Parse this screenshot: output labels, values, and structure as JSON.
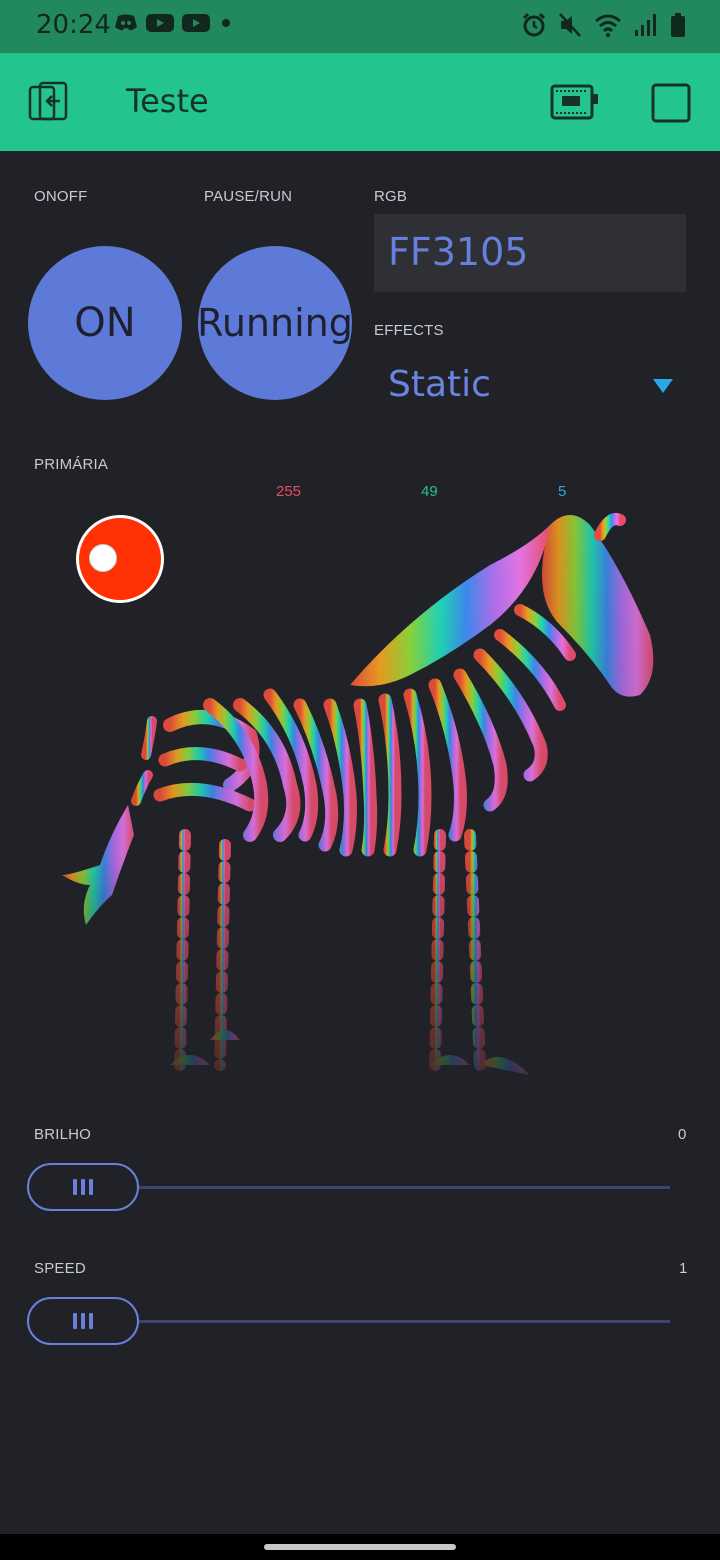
{
  "status_bar": {
    "time": "20:24",
    "left_icons": [
      "discord-icon",
      "youtube-icon",
      "youtube-icon",
      "dot-icon"
    ],
    "right_icons": [
      "alarm-icon",
      "mute-icon",
      "wifi-icon",
      "signal-icon",
      "battery-icon"
    ]
  },
  "app_bar": {
    "title": "Teste",
    "left_icon": "exit-device-icon",
    "right_icons": [
      "device-board-icon",
      "square-stop-icon"
    ]
  },
  "widgets": {
    "onoff": {
      "label": "ONOFF",
      "button_text": "ON"
    },
    "pause_run": {
      "label": "PAUSE/RUN",
      "button_text": "Running"
    },
    "rgb": {
      "label": "RGB",
      "value": "FF3105"
    },
    "effects": {
      "label": "EFFECTS",
      "value": "Static"
    },
    "primaria": {
      "label": "PRIMÁRIA",
      "r": "255",
      "g": "49",
      "b": "5",
      "preview_color": "#ff3105"
    },
    "brilho": {
      "label": "BRILHO",
      "value": "0"
    },
    "speed": {
      "label": "SPEED",
      "value": "1"
    }
  },
  "colors": {
    "accent": "#23c48e",
    "button": "#5e7ad9",
    "background": "#212227",
    "r_label": "#e84e63",
    "g_label": "#23c48e",
    "b_label": "#29a8e6"
  }
}
